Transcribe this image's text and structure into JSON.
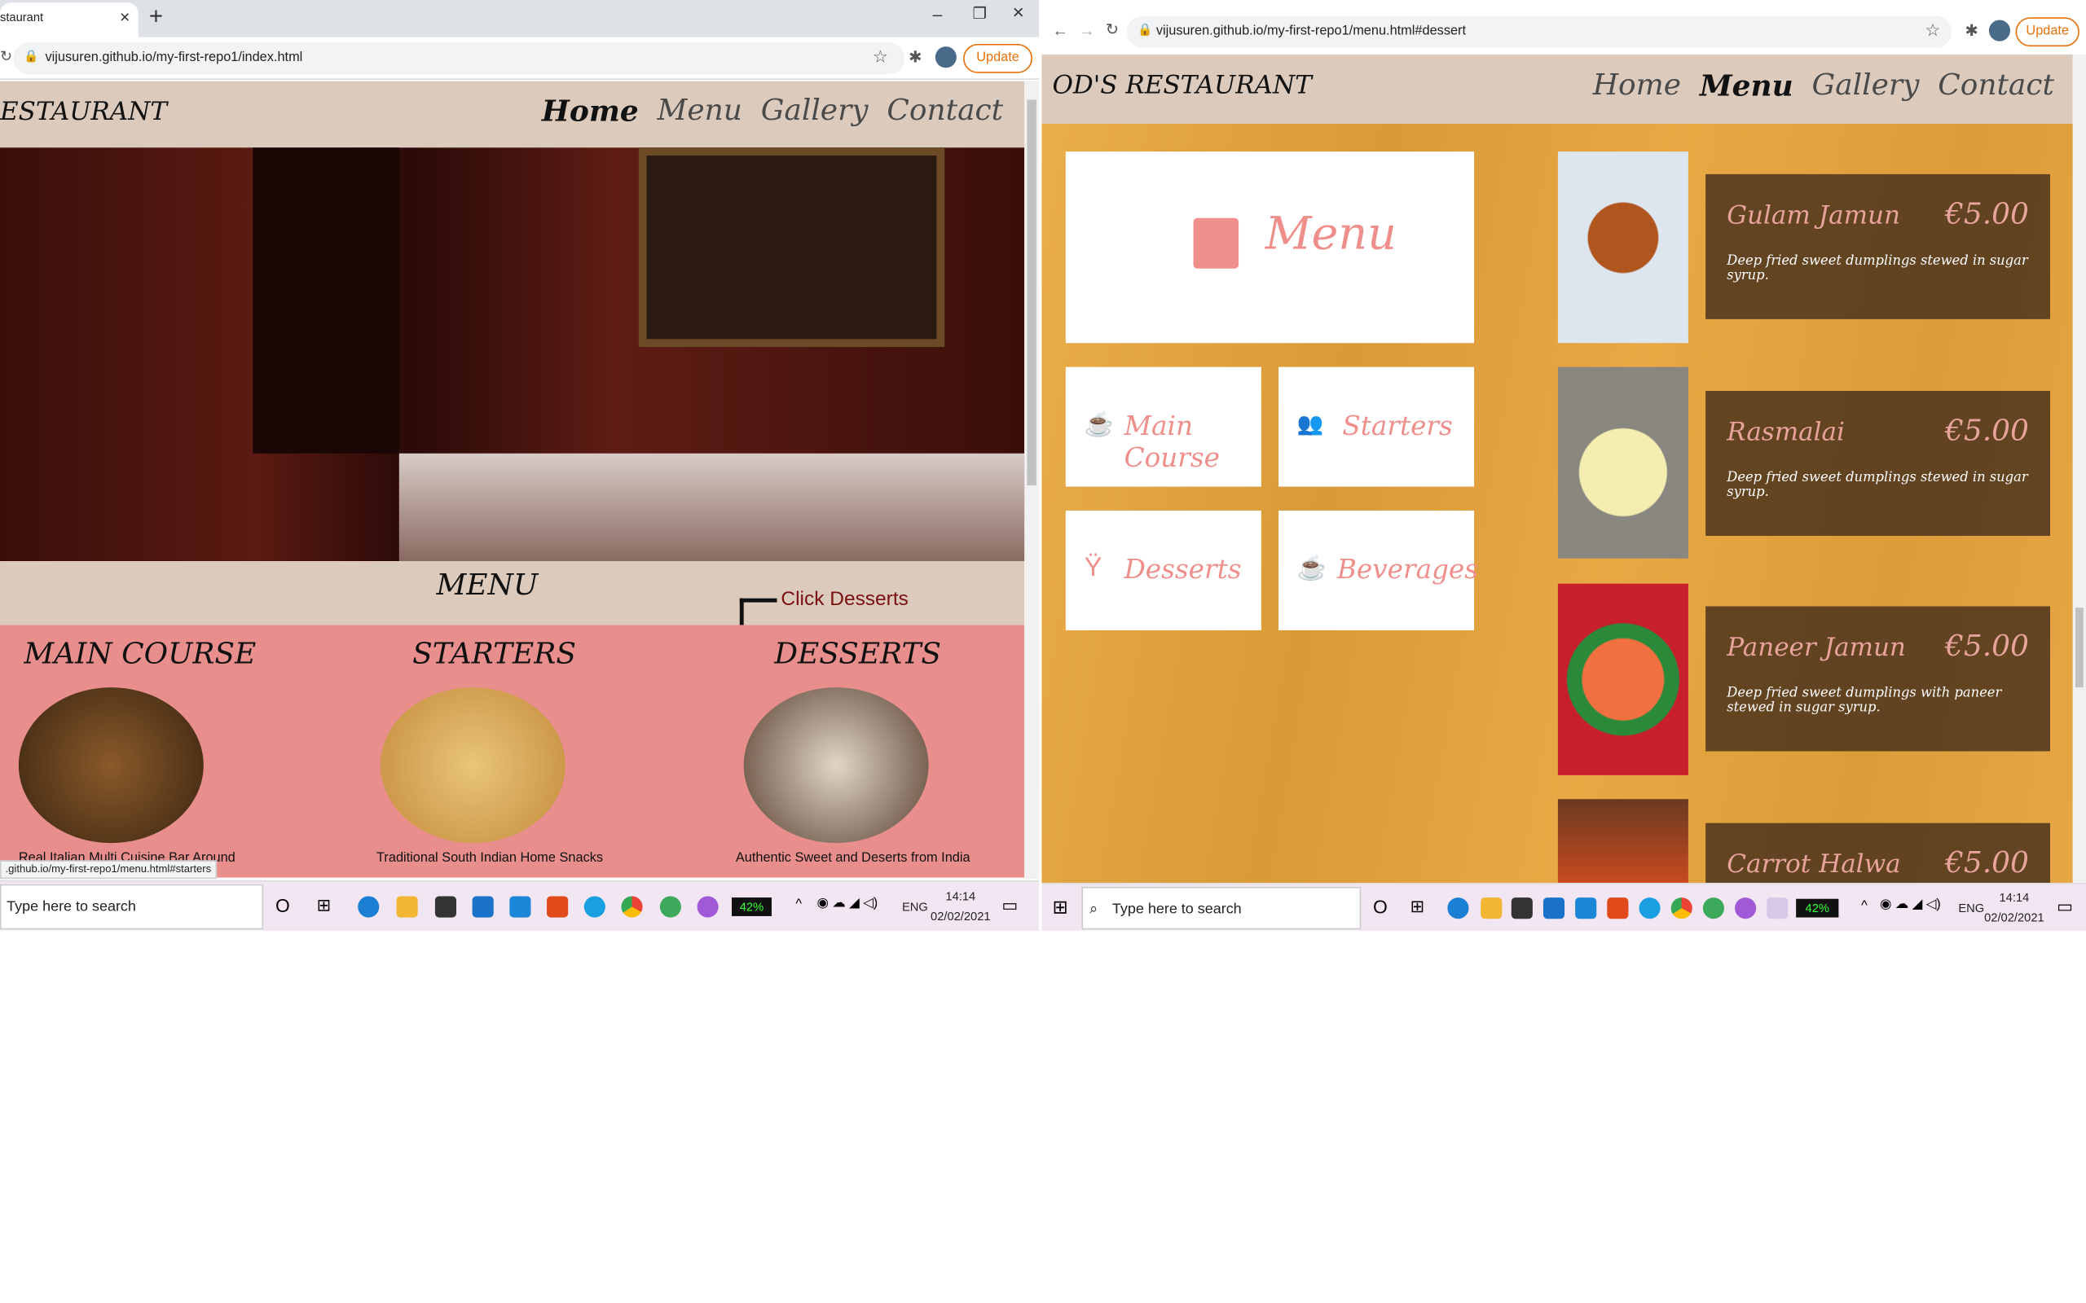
{
  "left": {
    "tab_title": "staurant",
    "url": "vijusuren.github.io/my-first-repo1/index.html",
    "update_label": "Update",
    "brand": "ESTAURANT",
    "nav": [
      "Home",
      "Menu",
      "Gallery",
      "Contact"
    ],
    "menu_heading": "MENU",
    "annotation": "Click Desserts",
    "categories": [
      {
        "title": "MAIN COURSE",
        "caption": "Real Italian Multi Cuisine Bar Around"
      },
      {
        "title": "STARTERS",
        "caption": "Traditional South Indian Home Snacks"
      },
      {
        "title": "DESSERTS",
        "caption": "Authentic Sweet and Deserts from India"
      }
    ],
    "status_url": ".github.io/my-first-repo1/menu.html#starters",
    "taskbar": {
      "search": "Type here to search",
      "battery": "42%",
      "lang": "ENG",
      "time": "14:14",
      "date": "02/02/2021"
    }
  },
  "right": {
    "url": "vijusuren.github.io/my-first-repo1/menu.html#dessert",
    "update_label": "Update",
    "brand": "OD'S RESTAURANT",
    "nav": [
      "Home",
      "Menu",
      "Gallery",
      "Contact"
    ],
    "menu_title": "Menu",
    "tiles": [
      {
        "label": "Main Course",
        "icon": "coffee-cup-icon"
      },
      {
        "label": "Starters",
        "icon": "users-icon"
      },
      {
        "label": "Desserts",
        "icon": "cocktail-glass-icon"
      },
      {
        "label": "Beverages",
        "icon": "coffee-cup-icon"
      }
    ],
    "dishes": [
      {
        "name": "Gulam Jamun",
        "price": "€5.00",
        "desc": "Deep fried sweet dumplings stewed in sugar syrup."
      },
      {
        "name": "Rasmalai",
        "price": "€5.00",
        "desc": "Deep fried sweet dumplings stewed in sugar syrup."
      },
      {
        "name": "Paneer Jamun",
        "price": "€5.00",
        "desc": "Deep fried sweet dumplings with paneer stewed in sugar syrup."
      },
      {
        "name": "Carrot Halwa",
        "price": "€5.00",
        "desc": ""
      }
    ],
    "taskbar": {
      "search": "Type here to search",
      "battery": "42%",
      "lang": "ENG",
      "time": "14:14",
      "date": "02/02/2021"
    }
  },
  "colors": {
    "accent_pink": "#ef8f8b",
    "nav_bar": "#dccbbd",
    "menu_band": "#e88f8d",
    "wood": "#e3a440"
  }
}
